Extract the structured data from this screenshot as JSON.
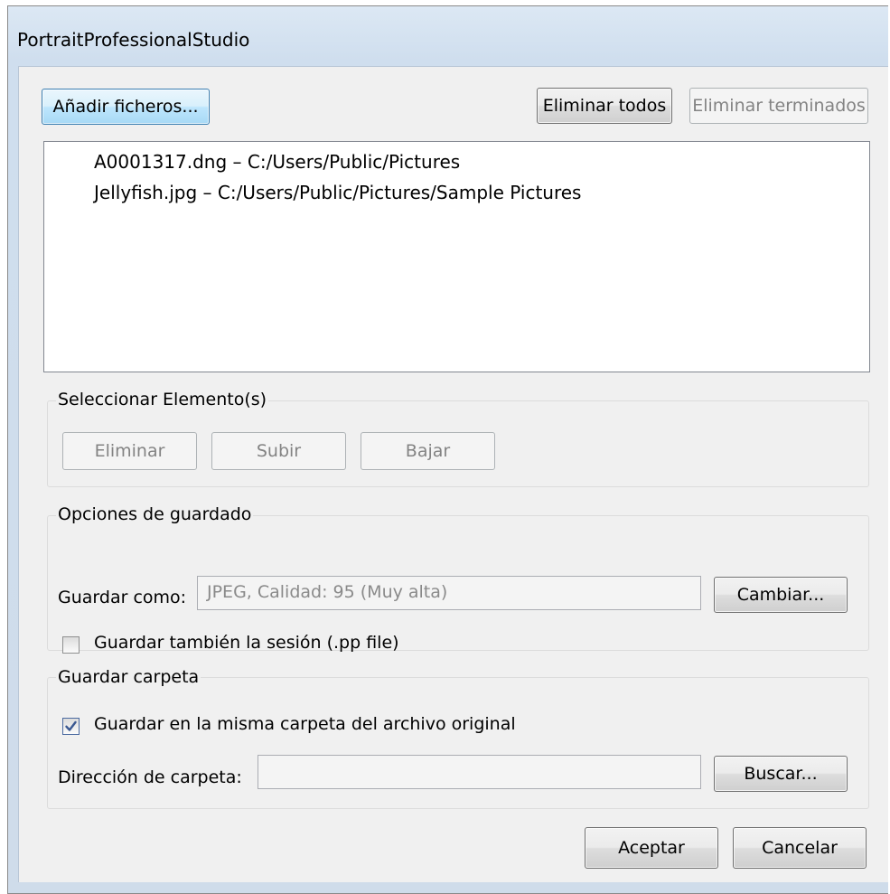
{
  "window": {
    "title": "PortraitProfessionalStudio"
  },
  "toolbar": {
    "add_files": "Añadir ficheros...",
    "remove_all": "Eliminar todos",
    "remove_finished": "Eliminar terminados"
  },
  "file_list": [
    {
      "text": "A0001317.dng  –  C:/Users/Public/Pictures"
    },
    {
      "text": "Jellyfish.jpg  –  C:/Users/Public/Pictures/Sample Pictures"
    }
  ],
  "select_group": {
    "label": "Seleccionar Elemento(s)",
    "remove": "Eliminar",
    "up": "Subir",
    "down": "Bajar"
  },
  "save_options": {
    "label": "Opciones de guardado",
    "save_as_label": "Guardar como:",
    "save_as_value": "JPEG, Calidad: 95 (Muy alta)",
    "change": "Cambiar...",
    "save_session_label": "Guardar también la sesión (.pp file)",
    "save_session_checked": false
  },
  "save_folder": {
    "label": "Guardar carpeta",
    "same_folder_label": "Guardar en la misma carpeta del archivo original",
    "same_folder_checked": true,
    "folder_path_label": "Dirección de carpeta:",
    "folder_path_value": "",
    "browse": "Buscar..."
  },
  "footer": {
    "accept": "Aceptar",
    "cancel": "Cancelar"
  }
}
